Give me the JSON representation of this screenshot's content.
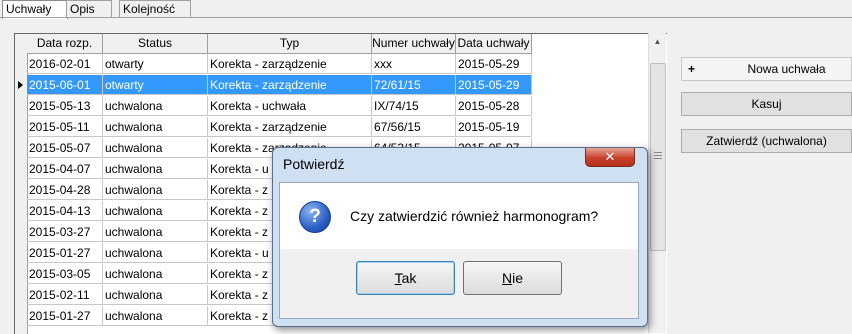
{
  "tabs": [
    {
      "label": "Uchwały",
      "active": true
    },
    {
      "label": "Opis",
      "active": false
    },
    {
      "label": "Kolejność",
      "active": false
    }
  ],
  "grid": {
    "columns": [
      "Data rozp.",
      "Status",
      "Typ",
      "Numer uchwały",
      "Data uchwały"
    ],
    "rows": [
      [
        "2016-02-01",
        "otwarty",
        "Korekta - zarządzenie",
        "xxx",
        "2015-05-29"
      ],
      [
        "2015-06-01",
        "otwarty",
        "Korekta - zarządzenie",
        "72/61/15",
        "2015-05-29"
      ],
      [
        "2015-05-13",
        "uchwalona",
        "Korekta - uchwała",
        "IX/74/15",
        "2015-05-28"
      ],
      [
        "2015-05-11",
        "uchwalona",
        "Korekta - zarządzenie",
        "67/56/15",
        "2015-05-19"
      ],
      [
        "2015-05-07",
        "uchwalona",
        "Korekta - zarządzenie",
        "64/53/15",
        "2015-05-07"
      ],
      [
        "2015-04-07",
        "uchwalona",
        "Korekta - u",
        "",
        ""
      ],
      [
        "2015-04-28",
        "uchwalona",
        "Korekta - z",
        "",
        ""
      ],
      [
        "2015-04-13",
        "uchwalona",
        "Korekta - z",
        "",
        ""
      ],
      [
        "2015-03-27",
        "uchwalona",
        "Korekta - z",
        "",
        ""
      ],
      [
        "2015-01-27",
        "uchwalona",
        "Korekta - u",
        "",
        ""
      ],
      [
        "2015-03-05",
        "uchwalona",
        "Korekta - z",
        "",
        ""
      ],
      [
        "2015-02-11",
        "uchwalona",
        "Korekta - z",
        "",
        ""
      ],
      [
        "2015-01-27",
        "uchwalona",
        "Korekta - z",
        "",
        ""
      ]
    ],
    "selected_row": 1
  },
  "buttons": {
    "new": "Nowa uchwała",
    "new_icon": "plus-icon",
    "delete": "Kasuj",
    "approve": "Zatwierdź (uchwalona)"
  },
  "dialog": {
    "title": "Potwierdź",
    "close_glyph": "✕",
    "icon": "question-icon",
    "icon_glyph": "?",
    "message": "Czy zatwierdzić również harmonogram?",
    "yes_prefix": "",
    "yes_key": "T",
    "yes_rest": "ak",
    "no_prefix": "",
    "no_key": "N",
    "no_rest": "ie"
  },
  "scrollbar": {
    "up_glyph": "▲",
    "down_glyph": "▼"
  },
  "colors": {
    "selection": "#3399ff",
    "close_button": "#c8412c"
  }
}
